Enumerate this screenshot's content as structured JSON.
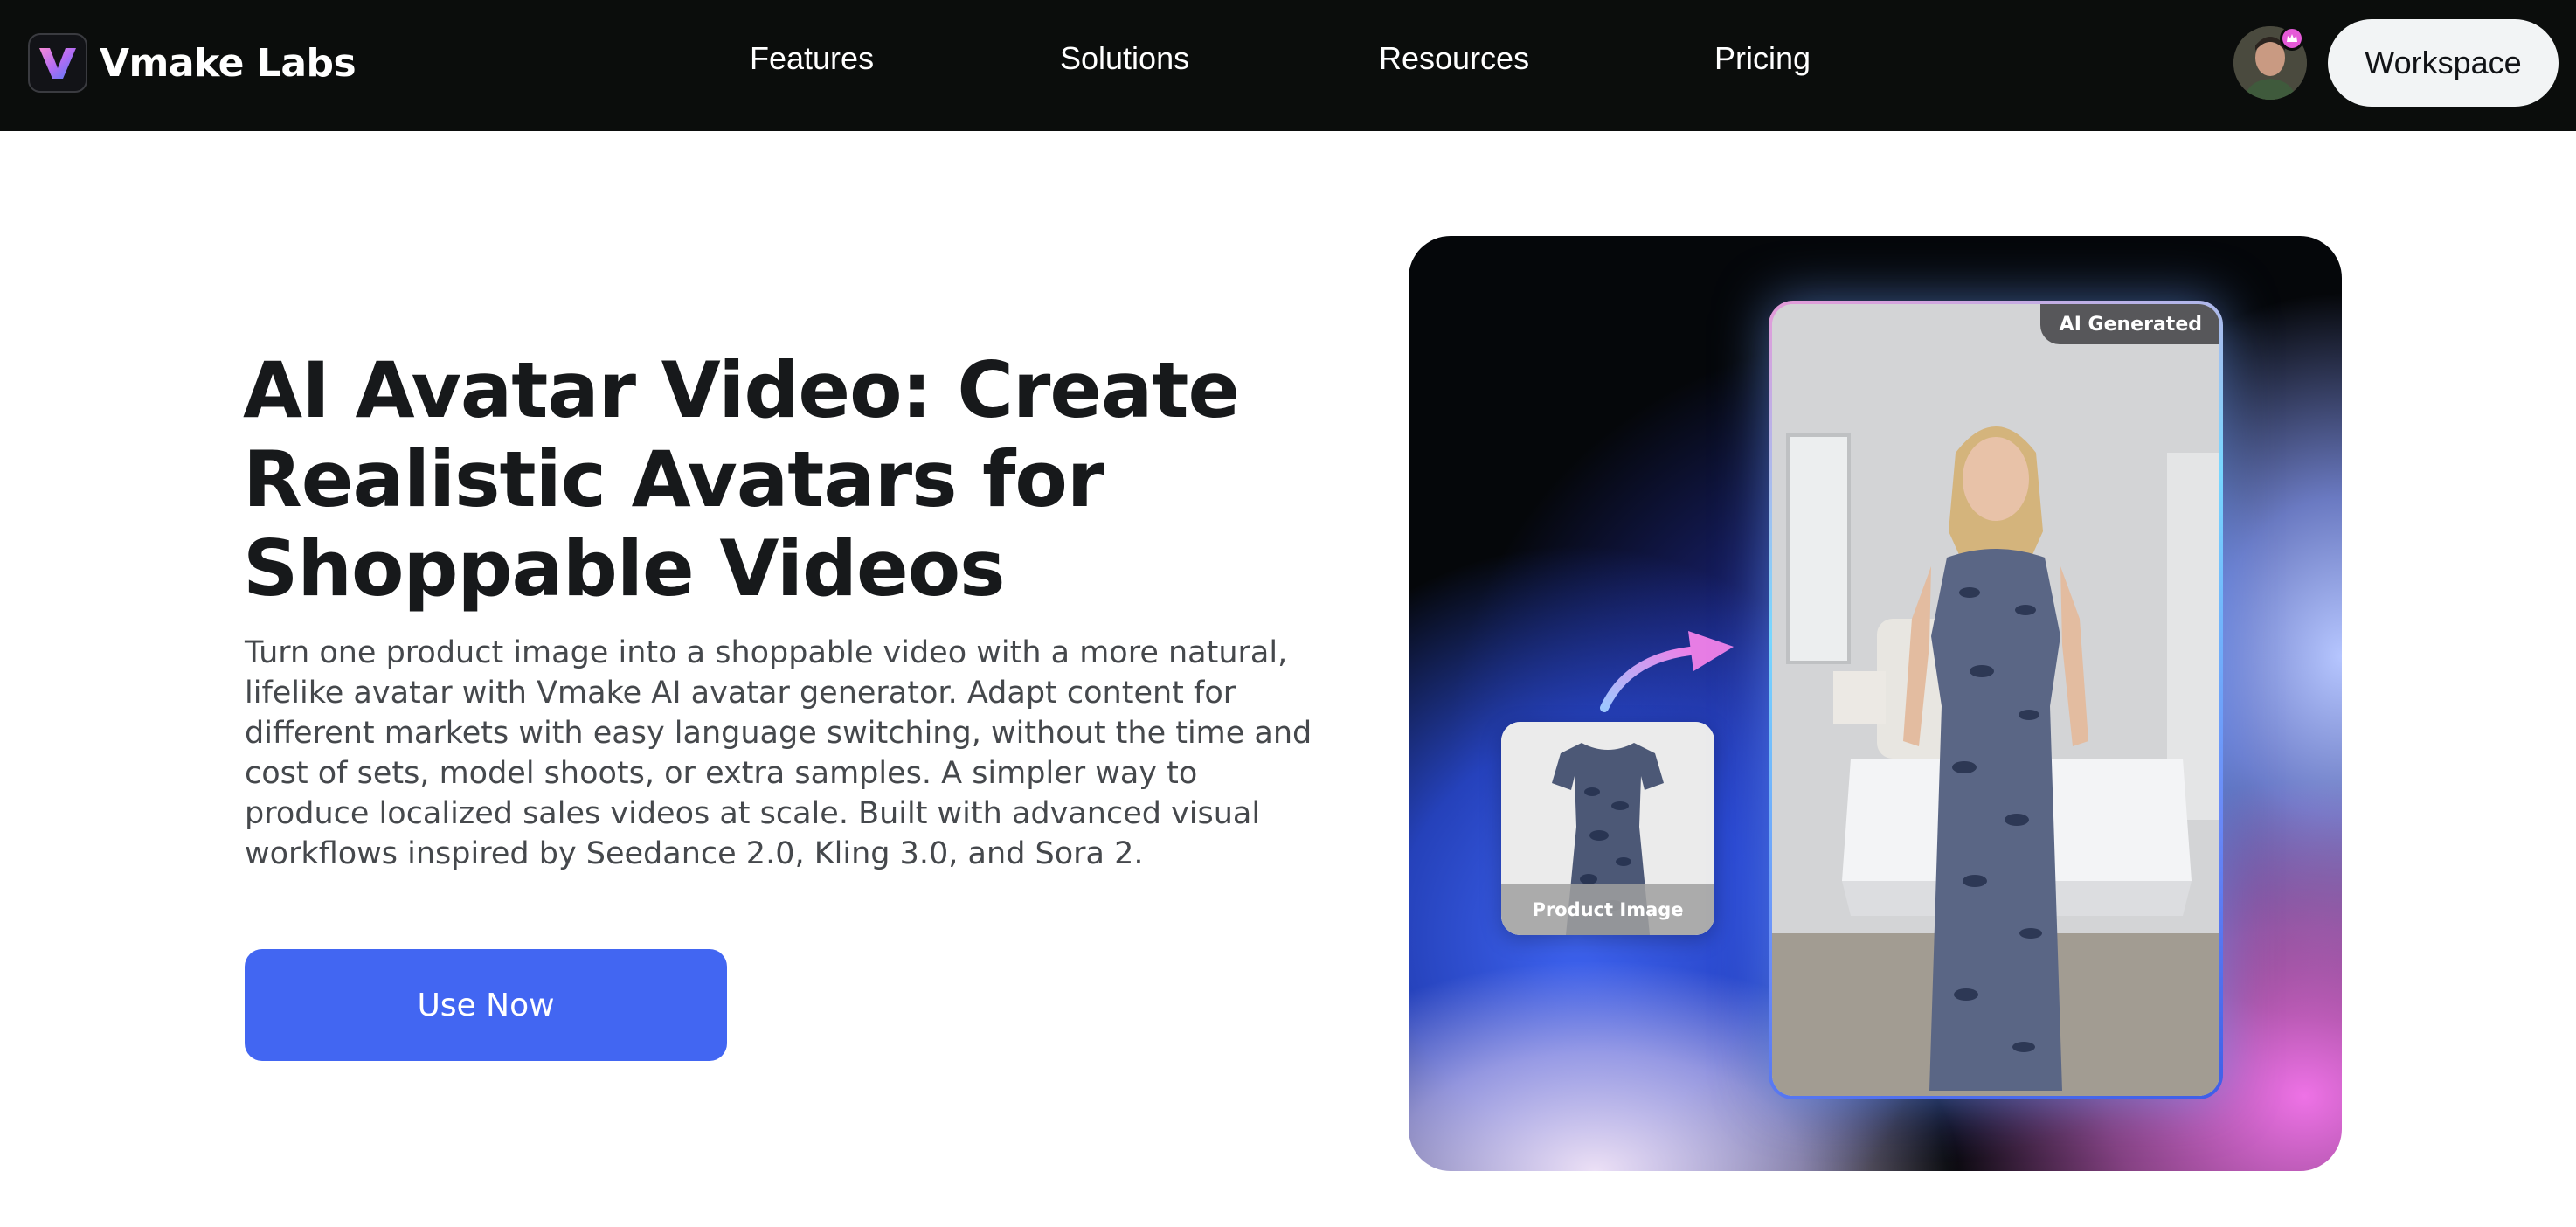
{
  "nav": {
    "brand": "Vmake Labs",
    "links": [
      {
        "label": "Features"
      },
      {
        "label": "Solutions"
      },
      {
        "label": "Resources"
      },
      {
        "label": "Pricing"
      }
    ],
    "workspace_label": "Workspace"
  },
  "hero": {
    "title": "AI Avatar Video: Create Realistic Avatars for Shoppable Videos",
    "description": "Turn one product image into a shoppable video with a more natural, lifelike avatar with Vmake AI avatar generator. Adapt content for different markets with easy language switching, without the time and cost of sets, model shoots, or extra samples. A simpler way to produce localized sales videos at scale. Built with advanced visual workflows inspired by Seedance 2.0, Kling 3.0, and Sora 2.",
    "cta_label": "Use Now"
  },
  "media": {
    "ai_badge": "AI Generated",
    "product_label": "Product Image"
  },
  "colors": {
    "nav_bg": "#0b0d0c",
    "cta_bg": "#4266f2",
    "title": "#17191b",
    "body_text": "#45484c",
    "avatar_badge": "#e55ad8"
  },
  "icons": {
    "logo": "v-logo-icon",
    "avatar_badge": "crown-badge-icon",
    "arrow": "curved-arrow-icon"
  }
}
